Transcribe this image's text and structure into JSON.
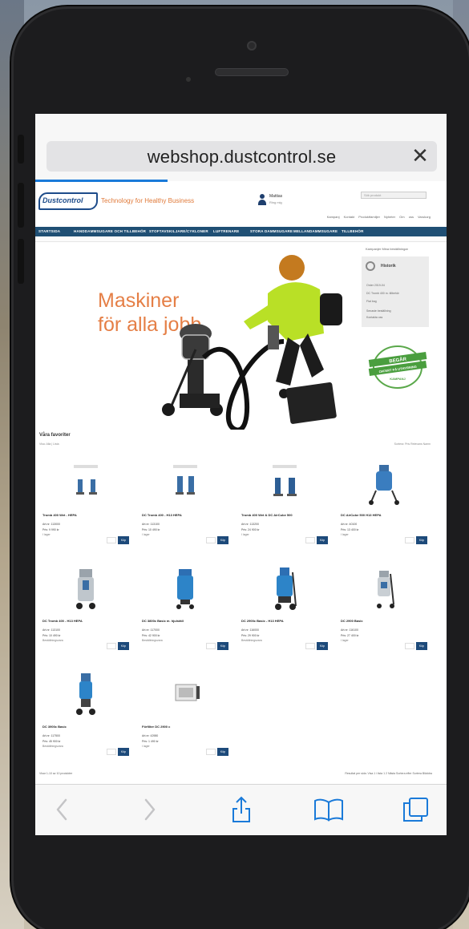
{
  "browser": {
    "url": "webshop.dustcontrol.se",
    "close_icon": "close-icon",
    "colors": {
      "accent": "#1a7ad9",
      "tint": "#1a7ad9"
    }
  },
  "header": {
    "logo_text": "Dustcontrol",
    "tagline": "Technology for Healthy Business",
    "user_name": "Mattias",
    "user_sub": "Ring mig",
    "search_placeholder": "Sök produkt",
    "util_links": "Kampanj  Kontakt  Produktfamiljer  Nyheter  Om oss  Varukorg"
  },
  "nav": {
    "items": [
      "STARTSIDA",
      "HANDDAMMSUGARE OCH TILLBEHÖR",
      "STOFTAVSKILJARE/CYKLONER",
      "LUFTRENARE",
      "STORA DAMMSUGARE",
      "MELLANDAMMSUGARE",
      "TILLBEHÖR"
    ],
    "bar_color": "#1f4f74"
  },
  "hero": {
    "headline_line1": "Maskiner",
    "headline_line2": "för alla jobb.",
    "headline_color": "#e57f46"
  },
  "side_panel": {
    "links": "Kampanjer  Mina beställningar",
    "title": "Historik",
    "lines": [
      "Order 2019-04",
      "DC Tromb 400 m. tillbehör",
      "Flat bag",
      "Senaste beställning",
      "Kontakta oss"
    ]
  },
  "stamp": {
    "line1": "BEGÄR",
    "line2": "OFFERT PÅ UTHYRNING",
    "line3": "KAMPANJ"
  },
  "products_section": {
    "title": "Våra favoriter",
    "filter_left": "Visa: Alla | Lista",
    "filter_right": "Sortera: Pris  Relevans  Namn"
  },
  "products": [
    {
      "name": "Tromb 400 Wet - HEPA",
      "artno": "Art.nr: 113000",
      "price": "Pris: 9 990 kr",
      "stock": "I lager",
      "buy": "Köp"
    },
    {
      "name": "DC Tromb 400 - H13 HEPA",
      "artno": "Art.nr: 113100",
      "price": "Pris: 10 490 kr",
      "stock": "I lager",
      "buy": "Köp"
    },
    {
      "name": "Tromb 400 Wet & DC AirCube 500",
      "artno": "Art.nr: 113200",
      "price": "Pris: 24 900 kr",
      "stock": "I lager",
      "buy": "Köp"
    },
    {
      "name": "DC AirCube 500 H13 HEPA",
      "artno": "Art.nr: 40100",
      "price": "Pris: 13 400 kr",
      "stock": "I lager",
      "buy": "Köp"
    },
    {
      "name": "DC Tromb 400 - H13 HEPA",
      "artno": "Art.nr: 113100",
      "price": "Pris: 10 490 kr",
      "stock": "Beställningsvara",
      "buy": "Köp"
    },
    {
      "name": "DC 3800c Basic m. hjulställ",
      "artno": "Art.nr: 117000",
      "price": "Pris: 42 900 kr",
      "stock": "Beställningsvara",
      "buy": "Köp"
    },
    {
      "name": "DC 2900c Basic - H13 HEPA",
      "artno": "Art.nr: 116000",
      "price": "Pris: 29 900 kr",
      "stock": "Beställningsvara",
      "buy": "Köp"
    },
    {
      "name": "DC 2900 Basic",
      "artno": "Art.nr: 116100",
      "price": "Pris: 27 400 kr",
      "stock": "I lager",
      "buy": "Köp"
    },
    {
      "name": "DC 3900c Basic",
      "artno": "Art.nr: 117500",
      "price": "Pris: 45 900 kr",
      "stock": "Beställningsvara",
      "buy": "Köp"
    },
    {
      "name": "Förfilter DC 2900 c",
      "artno": "Art.nr: 42980",
      "price": "Pris: 1 490 kr",
      "stock": "I lager",
      "buy": "Köp"
    }
  ],
  "footer": {
    "left": "Visar 1-10 av 10 produkter",
    "right": "Resultat per sida:  Visa 1 i lista  1 2 Nästa  Sortera efter  Sortera  Bläddra"
  },
  "toolbar": {
    "back_icon": "chevron-left-icon",
    "forward_icon": "chevron-right-icon",
    "share_icon": "share-icon",
    "bookmarks_icon": "book-icon",
    "tabs_icon": "tabs-icon"
  }
}
